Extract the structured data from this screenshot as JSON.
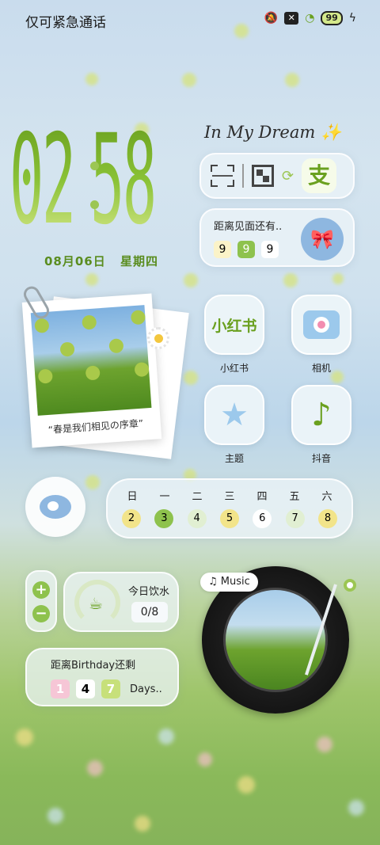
{
  "status_bar": {
    "carrier_text": "仅可紧急通话",
    "icons": [
      "mute-icon",
      "close-box-icon",
      "wifi-icon",
      "battery-icon",
      "charging-icon"
    ],
    "battery": "99"
  },
  "clock": {
    "hour": "02",
    "minute": "58",
    "date": "08月06日 星期四"
  },
  "dream_text": "In My Dream",
  "quick_bar": {
    "icons": [
      "scan-icon",
      "qr-code-icon",
      "swap-icon",
      "alipay-icon"
    ],
    "alipay_glyph": "支"
  },
  "meet_countdown": {
    "label": "距离见面还有..",
    "digits": [
      "9",
      "9",
      "9"
    ]
  },
  "photo": {
    "caption": "“春是我们相见の序章”"
  },
  "apps": [
    {
      "name": "小红书",
      "icon": "xiaohongshu-icon",
      "glyph": "小红书"
    },
    {
      "name": "相机",
      "icon": "camera-icon"
    },
    {
      "name": "主题",
      "icon": "theme-star-icon",
      "glyph": "★"
    },
    {
      "name": "抖音",
      "icon": "tiktok-icon",
      "glyph": "♪"
    }
  ],
  "week": {
    "days": [
      "日",
      "一",
      "二",
      "三",
      "四",
      "五",
      "六"
    ],
    "dates": [
      "2",
      "3",
      "4",
      "5",
      "6",
      "7",
      "8"
    ]
  },
  "stepper": {
    "plus": "+",
    "minus": "−"
  },
  "water": {
    "label": "今日饮水",
    "value": "0/8"
  },
  "birthday": {
    "label": "距离Birthday还剩",
    "digits": [
      "1",
      "4",
      "7"
    ],
    "suffix": "Days.."
  },
  "music": {
    "tag": "Music"
  },
  "colors": {
    "accent_green": "#8ec24d",
    "accent_blue": "#8eb7e0",
    "pink": "#f6c6d6",
    "yellow": "#f2e48a"
  }
}
